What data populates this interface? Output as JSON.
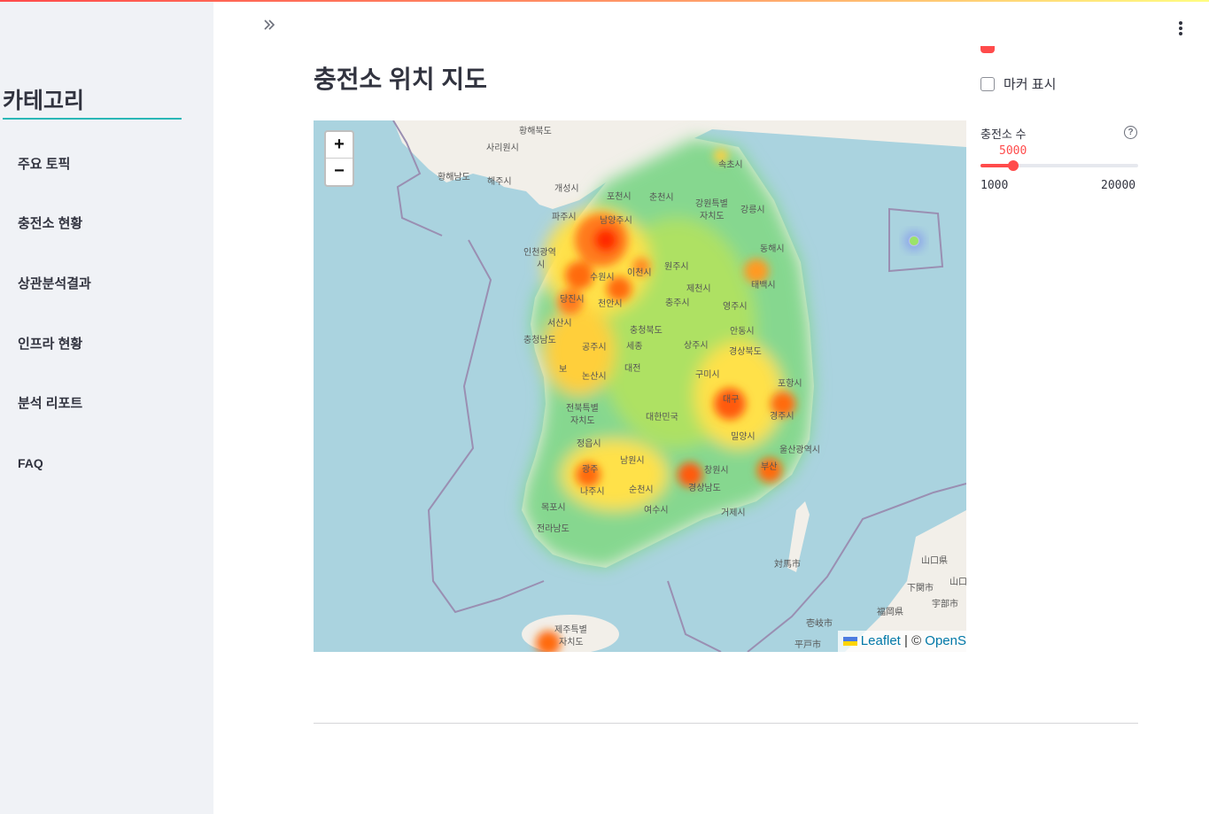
{
  "sidebar": {
    "title": "카테고리",
    "items": [
      {
        "label": "주요 토픽"
      },
      {
        "label": "충전소 현황"
      },
      {
        "label": "상관분석결과"
      },
      {
        "label": "인프라 현황"
      },
      {
        "label": "분석 리포트"
      },
      {
        "label": "FAQ"
      }
    ]
  },
  "header": {
    "collapse_icon": "double-chevron-right-icon",
    "menu_icon": "kebab-menu-icon"
  },
  "main": {
    "title": "충전소 위치 지도"
  },
  "map": {
    "zoom_in": "+",
    "zoom_out": "−",
    "attribution": {
      "leaflet": "Leaflet",
      "separator": " | © ",
      "osm": "OpenS"
    },
    "labels": {
      "hwanghae_n": "황해북도",
      "sariwon": "사리원시",
      "hwanghae_s": "황해남도",
      "haeju": "해주시",
      "kaesong": "개성시",
      "pocheon": "포천시",
      "chuncheon": "춘천시",
      "gangwon": "강원특별",
      "gangwon2": "자치도",
      "sokcho": "속초시",
      "gangneung": "강릉시",
      "paju": "파주시",
      "namyangju": "남양주시",
      "incheon": "인천광역",
      "incheon2": "시",
      "donghae": "동해시",
      "wonju": "원주시",
      "suwon": "수원시",
      "icheon": "이천시",
      "jecheon": "제천시",
      "taebaek": "태백시",
      "dangjin": "당진시",
      "cheonan": "천안시",
      "chungju": "충주시",
      "yeongju": "영주시",
      "seosan": "서산시",
      "chungbuk": "충청북도",
      "andong": "안동시",
      "chungnam": "충청남도",
      "gongju": "공주시",
      "sejong": "세종",
      "sangju": "상주시",
      "gyeongbuk": "경상북도",
      "boryeong": "보",
      "daejeon": "대전",
      "nonsan": "논산시",
      "gumi": "구미시",
      "pohang": "포항시",
      "jeonbuk": "전북특별",
      "jeonbuk2": "자치도",
      "daegu": "대구",
      "daehan": "대한민국",
      "gyeongju": "경주시",
      "jeongeup": "정읍시",
      "miryang": "밀양시",
      "ulsan": "울산광역시",
      "namwon": "남원시",
      "gwangju": "광주",
      "changwon": "창원시",
      "busan": "부산",
      "naju": "나주시",
      "suncheon": "순천시",
      "gyeongnam": "경상남도",
      "mokpo": "목포시",
      "yeosu": "여수시",
      "geoje": "거제시",
      "jeonnam": "전라남도",
      "tsushima": "対馬市",
      "yamaguchi": "山口県",
      "yamaguchi2": "山口",
      "shimonoseki": "下関市",
      "ube": "宇部市",
      "fukuoka": "福岡県",
      "iki": "壱岐市",
      "hirado": "平戸市",
      "jeju": "제주특별",
      "jeju2": "자치도"
    }
  },
  "controls": {
    "marker_checkbox": {
      "label": "마커 표시",
      "checked": false
    },
    "slider": {
      "label": "충전소 수",
      "value": "5000",
      "min": "1000",
      "max": "20000",
      "value_num": 5000,
      "min_num": 1000,
      "max_num": 20000
    }
  },
  "colors": {
    "accent": "#ff4b4b",
    "sidebar_bg": "#f0f2f6",
    "underline": "#2ab7b7",
    "sea": "#aad3df",
    "land": "#f2efe9"
  }
}
